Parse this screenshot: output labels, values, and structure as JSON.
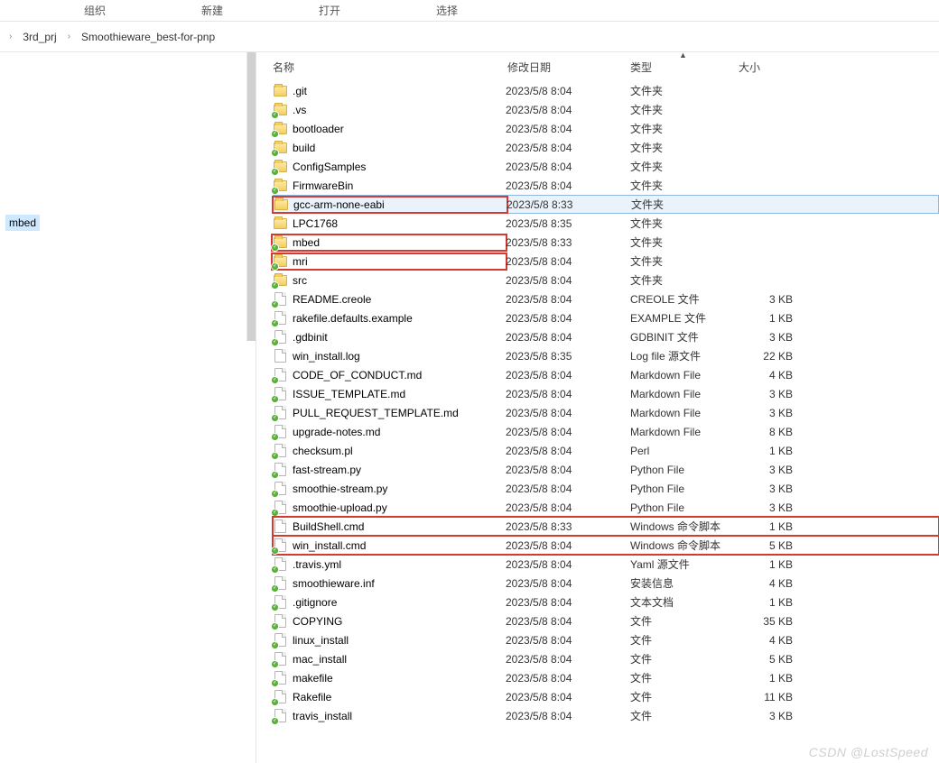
{
  "ribbon": [
    "组织",
    "新建",
    "打开",
    "选择"
  ],
  "breadcrumb": [
    "3rd_prj",
    "Smoothieware_best-for-pnp"
  ],
  "sidebar": {
    "selected": "mbed"
  },
  "columns": {
    "name": "名称",
    "date": "修改日期",
    "type": "类型",
    "size": "大小"
  },
  "rows": [
    {
      "icon": "folder",
      "sync": false,
      "name": ".git",
      "date": "2023/5/8 8:04",
      "type": "文件夹",
      "size": "",
      "selected": false,
      "hiName": false,
      "hiRow": false
    },
    {
      "icon": "folder",
      "sync": true,
      "name": ".vs",
      "date": "2023/5/8 8:04",
      "type": "文件夹",
      "size": "",
      "selected": false,
      "hiName": false,
      "hiRow": false
    },
    {
      "icon": "folder",
      "sync": true,
      "name": "bootloader",
      "date": "2023/5/8 8:04",
      "type": "文件夹",
      "size": "",
      "selected": false,
      "hiName": false,
      "hiRow": false
    },
    {
      "icon": "folder",
      "sync": true,
      "name": "build",
      "date": "2023/5/8 8:04",
      "type": "文件夹",
      "size": "",
      "selected": false,
      "hiName": false,
      "hiRow": false
    },
    {
      "icon": "folder",
      "sync": true,
      "name": "ConfigSamples",
      "date": "2023/5/8 8:04",
      "type": "文件夹",
      "size": "",
      "selected": false,
      "hiName": false,
      "hiRow": false
    },
    {
      "icon": "folder",
      "sync": true,
      "name": "FirmwareBin",
      "date": "2023/5/8 8:04",
      "type": "文件夹",
      "size": "",
      "selected": false,
      "hiName": false,
      "hiRow": false
    },
    {
      "icon": "folder",
      "sync": false,
      "name": "gcc-arm-none-eabi",
      "date": "2023/5/8 8:33",
      "type": "文件夹",
      "size": "",
      "selected": true,
      "hiName": true,
      "hiRow": false
    },
    {
      "icon": "folder",
      "sync": false,
      "name": "LPC1768",
      "date": "2023/5/8 8:35",
      "type": "文件夹",
      "size": "",
      "selected": false,
      "hiName": false,
      "hiRow": false
    },
    {
      "icon": "folder",
      "sync": true,
      "name": "mbed",
      "date": "2023/5/8 8:33",
      "type": "文件夹",
      "size": "",
      "selected": false,
      "hiName": true,
      "hiRow": false
    },
    {
      "icon": "folder",
      "sync": true,
      "name": "mri",
      "date": "2023/5/8 8:04",
      "type": "文件夹",
      "size": "",
      "selected": false,
      "hiName": true,
      "hiRow": false
    },
    {
      "icon": "folder",
      "sync": true,
      "name": "src",
      "date": "2023/5/8 8:04",
      "type": "文件夹",
      "size": "",
      "selected": false,
      "hiName": false,
      "hiRow": false
    },
    {
      "icon": "file",
      "sync": true,
      "name": "README.creole",
      "date": "2023/5/8 8:04",
      "type": "CREOLE 文件",
      "size": "3 KB",
      "selected": false,
      "hiName": false,
      "hiRow": false
    },
    {
      "icon": "file",
      "sync": true,
      "name": "rakefile.defaults.example",
      "date": "2023/5/8 8:04",
      "type": "EXAMPLE 文件",
      "size": "1 KB",
      "selected": false,
      "hiName": false,
      "hiRow": false
    },
    {
      "icon": "file",
      "sync": true,
      "name": ".gdbinit",
      "date": "2023/5/8 8:04",
      "type": "GDBINIT 文件",
      "size": "3 KB",
      "selected": false,
      "hiName": false,
      "hiRow": false
    },
    {
      "icon": "file",
      "sync": false,
      "name": "win_install.log",
      "date": "2023/5/8 8:35",
      "type": "Log file 源文件",
      "size": "22 KB",
      "selected": false,
      "hiName": false,
      "hiRow": false
    },
    {
      "icon": "file",
      "sync": true,
      "name": "CODE_OF_CONDUCT.md",
      "date": "2023/5/8 8:04",
      "type": "Markdown File",
      "size": "4 KB",
      "selected": false,
      "hiName": false,
      "hiRow": false
    },
    {
      "icon": "file",
      "sync": true,
      "name": "ISSUE_TEMPLATE.md",
      "date": "2023/5/8 8:04",
      "type": "Markdown File",
      "size": "3 KB",
      "selected": false,
      "hiName": false,
      "hiRow": false
    },
    {
      "icon": "file",
      "sync": true,
      "name": "PULL_REQUEST_TEMPLATE.md",
      "date": "2023/5/8 8:04",
      "type": "Markdown File",
      "size": "3 KB",
      "selected": false,
      "hiName": false,
      "hiRow": false
    },
    {
      "icon": "file",
      "sync": true,
      "name": "upgrade-notes.md",
      "date": "2023/5/8 8:04",
      "type": "Markdown File",
      "size": "8 KB",
      "selected": false,
      "hiName": false,
      "hiRow": false
    },
    {
      "icon": "file",
      "sync": true,
      "name": "checksum.pl",
      "date": "2023/5/8 8:04",
      "type": "Perl",
      "size": "1 KB",
      "selected": false,
      "hiName": false,
      "hiRow": false
    },
    {
      "icon": "file",
      "sync": true,
      "name": "fast-stream.py",
      "date": "2023/5/8 8:04",
      "type": "Python File",
      "size": "3 KB",
      "selected": false,
      "hiName": false,
      "hiRow": false
    },
    {
      "icon": "file",
      "sync": true,
      "name": "smoothie-stream.py",
      "date": "2023/5/8 8:04",
      "type": "Python File",
      "size": "3 KB",
      "selected": false,
      "hiName": false,
      "hiRow": false
    },
    {
      "icon": "file",
      "sync": true,
      "name": "smoothie-upload.py",
      "date": "2023/5/8 8:04",
      "type": "Python File",
      "size": "3 KB",
      "selected": false,
      "hiName": false,
      "hiRow": false
    },
    {
      "icon": "file",
      "sync": false,
      "name": "BuildShell.cmd",
      "date": "2023/5/8 8:33",
      "type": "Windows 命令脚本",
      "size": "1 KB",
      "selected": false,
      "hiName": false,
      "hiRow": true
    },
    {
      "icon": "file",
      "sync": true,
      "name": "win_install.cmd",
      "date": "2023/5/8 8:04",
      "type": "Windows 命令脚本",
      "size": "5 KB",
      "selected": false,
      "hiName": false,
      "hiRow": true
    },
    {
      "icon": "file",
      "sync": true,
      "name": ".travis.yml",
      "date": "2023/5/8 8:04",
      "type": "Yaml 源文件",
      "size": "1 KB",
      "selected": false,
      "hiName": false,
      "hiRow": false
    },
    {
      "icon": "file",
      "sync": true,
      "name": "smoothieware.inf",
      "date": "2023/5/8 8:04",
      "type": "安装信息",
      "size": "4 KB",
      "selected": false,
      "hiName": false,
      "hiRow": false
    },
    {
      "icon": "file",
      "sync": true,
      "name": ".gitignore",
      "date": "2023/5/8 8:04",
      "type": "文本文档",
      "size": "1 KB",
      "selected": false,
      "hiName": false,
      "hiRow": false
    },
    {
      "icon": "file",
      "sync": true,
      "name": "COPYING",
      "date": "2023/5/8 8:04",
      "type": "文件",
      "size": "35 KB",
      "selected": false,
      "hiName": false,
      "hiRow": false
    },
    {
      "icon": "file",
      "sync": true,
      "name": "linux_install",
      "date": "2023/5/8 8:04",
      "type": "文件",
      "size": "4 KB",
      "selected": false,
      "hiName": false,
      "hiRow": false
    },
    {
      "icon": "file",
      "sync": true,
      "name": "mac_install",
      "date": "2023/5/8 8:04",
      "type": "文件",
      "size": "5 KB",
      "selected": false,
      "hiName": false,
      "hiRow": false
    },
    {
      "icon": "file",
      "sync": true,
      "name": "makefile",
      "date": "2023/5/8 8:04",
      "type": "文件",
      "size": "1 KB",
      "selected": false,
      "hiName": false,
      "hiRow": false
    },
    {
      "icon": "file",
      "sync": true,
      "name": "Rakefile",
      "date": "2023/5/8 8:04",
      "type": "文件",
      "size": "11 KB",
      "selected": false,
      "hiName": false,
      "hiRow": false
    },
    {
      "icon": "file",
      "sync": true,
      "name": "travis_install",
      "date": "2023/5/8 8:04",
      "type": "文件",
      "size": "3 KB",
      "selected": false,
      "hiName": false,
      "hiRow": false
    }
  ],
  "watermark": "CSDN @LostSpeed"
}
